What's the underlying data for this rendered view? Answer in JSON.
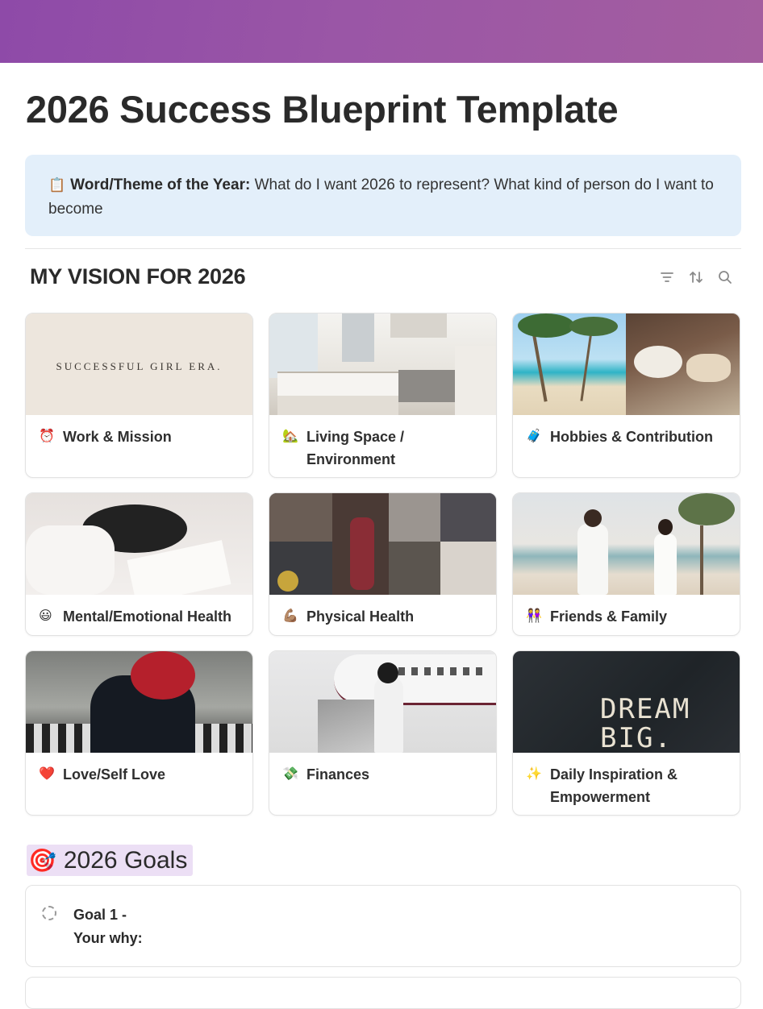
{
  "page": {
    "title": "2026 Success Blueprint Template"
  },
  "callout": {
    "icon": "clipboard-icon",
    "icon_glyph": "📋",
    "bold": "Word/Theme of the Year:",
    "text": " What do I want 2026 to represent? What kind of person do I want to become"
  },
  "vision": {
    "title": "MY VISION FOR 2026",
    "tools": [
      "filter-icon",
      "sort-icon",
      "search-icon"
    ],
    "cards": [
      {
        "label": "Work & Mission",
        "emoji": "⏰",
        "cover_text": "SUCCESSFUL GIRL ERA."
      },
      {
        "label": "Living Space / Environment",
        "emoji": "🏡"
      },
      {
        "label": "Hobbies & Contribution",
        "emoji": "🧳"
      },
      {
        "label": "Mental/Emotional Health",
        "emoji": "😃"
      },
      {
        "label": "Physical Health",
        "emoji": "💪🏽"
      },
      {
        "label": "Friends & Family",
        "emoji": "👭"
      },
      {
        "label": "Love/Self Love",
        "emoji": "❤️"
      },
      {
        "label": "Finances",
        "emoji": "💸"
      },
      {
        "label": "Daily Inspiration & Empowerment",
        "emoji": "✨",
        "cover_text": "DREAM BIG."
      }
    ]
  },
  "goals": {
    "title": "2026 Goals",
    "emoji": "🎯",
    "items": [
      {
        "line1": "Goal 1 -",
        "line2": "Your why:"
      }
    ]
  },
  "colors": {
    "cover_start": "#8e4aa8",
    "cover_end": "#a45e9f",
    "callout_bg": "#e3effa",
    "goals_highlight": "#ecdff5"
  }
}
